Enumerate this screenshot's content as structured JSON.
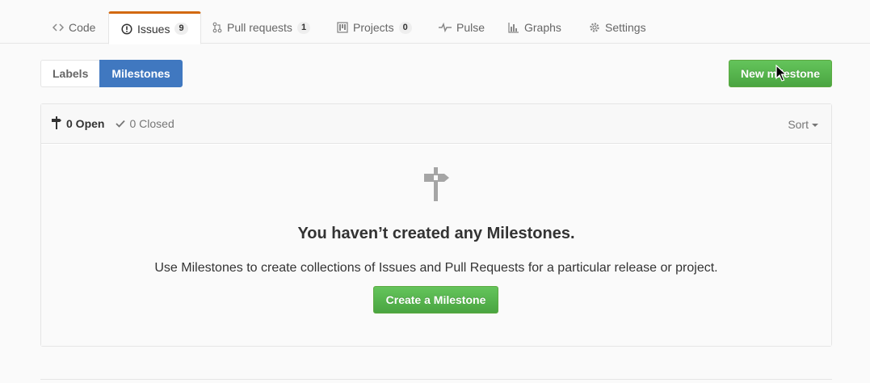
{
  "repo_nav": {
    "tabs": [
      {
        "label": "Code",
        "icon": "code-icon"
      },
      {
        "label": "Issues",
        "icon": "issue-opened-icon",
        "count": "9",
        "selected": true
      },
      {
        "label": "Pull requests",
        "icon": "git-pull-request-icon",
        "count": "1"
      },
      {
        "label": "Projects",
        "icon": "project-icon",
        "count": "0"
      },
      {
        "label": "Pulse",
        "icon": "pulse-icon"
      },
      {
        "label": "Graphs",
        "icon": "graph-icon"
      },
      {
        "label": "Settings",
        "icon": "gear-icon"
      }
    ]
  },
  "subnav": {
    "labels": "Labels",
    "milestones": "Milestones",
    "new_milestone": "New milestone"
  },
  "states": {
    "open": "0 Open",
    "closed": "0 Closed",
    "sort": "Sort"
  },
  "blankslate": {
    "icon": "milestone-icon",
    "title": "You haven’t created any Milestones.",
    "description": "Use Milestones to create collections of Issues and Pull Requests for a particular release or project.",
    "button": "Create a Milestone"
  },
  "colors": {
    "selected_tab_border": "#d26911",
    "active_subnav": "#4078c0",
    "primary_button": "#55b14c"
  }
}
